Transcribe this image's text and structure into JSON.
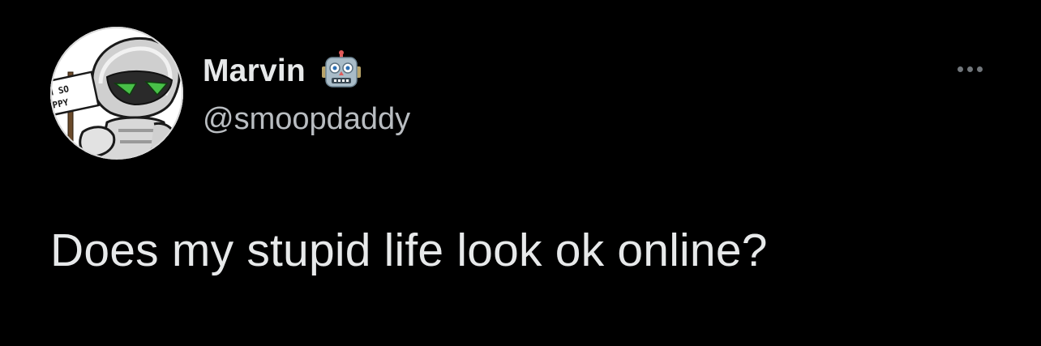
{
  "tweet": {
    "author": {
      "display_name": "Marvin",
      "handle": "@smoopdaddy",
      "name_emoji": "robot-face-icon",
      "avatar": {
        "icon": "marvin-robot-avatar",
        "sign_text_line1": "M SO",
        "sign_text_line2": "APPY"
      }
    },
    "more_icon": "more-horizontal-icon",
    "text": "Does my stupid life look ok online?"
  },
  "colors": {
    "background": "#000000",
    "primary_text": "#e7e9ea",
    "secondary_text": "#b9bdc1",
    "icon_muted": "#71767b"
  }
}
